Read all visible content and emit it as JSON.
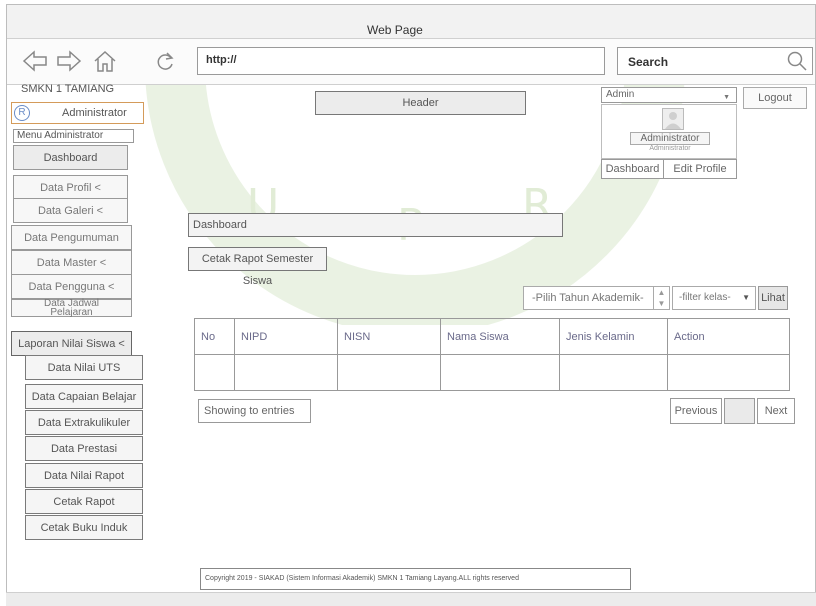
{
  "window": {
    "title": "Web Page"
  },
  "browser": {
    "url": "http://",
    "search_label": "Search",
    "icons": [
      "back-arrow-icon",
      "forward-arrow-icon",
      "home-icon",
      "refresh-icon",
      "search-icon"
    ]
  },
  "sidebar": {
    "brand": "SMKN 1 TAMIANG",
    "admin_badge": "Administrator",
    "menu_title": "Menu Administrator",
    "items": [
      {
        "label": "Dashboard"
      },
      {
        "label": "Data Profil <"
      },
      {
        "label": "Data Galeri <"
      },
      {
        "label": "Data Pengumuman"
      },
      {
        "label": "Data Master <"
      },
      {
        "label": "Data Pengguna <"
      },
      {
        "label": "Data Jadwal Pelajaran"
      },
      {
        "label": "Laporan Nilai Siswa <"
      }
    ],
    "sub_items": [
      {
        "label": "Data Nilai UTS"
      },
      {
        "label": "Data Capaian Belajar"
      },
      {
        "label": "Data Extrakulikuler"
      },
      {
        "label": "Data Prestasi"
      },
      {
        "label": "Data Nilai Rapot"
      },
      {
        "label": "Cetak Rapot"
      },
      {
        "label": "Cetak Buku Induk"
      }
    ]
  },
  "header": {
    "label": "Header"
  },
  "user_menu": {
    "select_value": "Admin",
    "logout": "Logout",
    "name": "Administrator",
    "role": "Administrator",
    "tab_dashboard": "Dashboard",
    "tab_edit_profile": "Edit Profile"
  },
  "main": {
    "breadcrumb": "Dashboard",
    "page_title": "Cetak Rapot Semester Siswa",
    "filter_tahun": "-Pilih Tahun Akademik-",
    "filter_kelas": "-filter kelas-",
    "lihat": "Lihat",
    "table": {
      "columns": [
        "No",
        "NIPD",
        "NISN",
        "Nama Siswa",
        "Jenis Kelamin",
        "Action"
      ],
      "rows": [
        [
          "",
          "",
          "",
          "",
          "",
          ""
        ]
      ]
    },
    "showing": "Showing to entries",
    "previous": "Previous",
    "page": "",
    "next": "Next"
  },
  "footer": {
    "text": "Copyright 2019 - SIAKAD (Sistem Informasi Akademik) SMKN 1 Tamiang Layang.ALL rights reserved"
  }
}
